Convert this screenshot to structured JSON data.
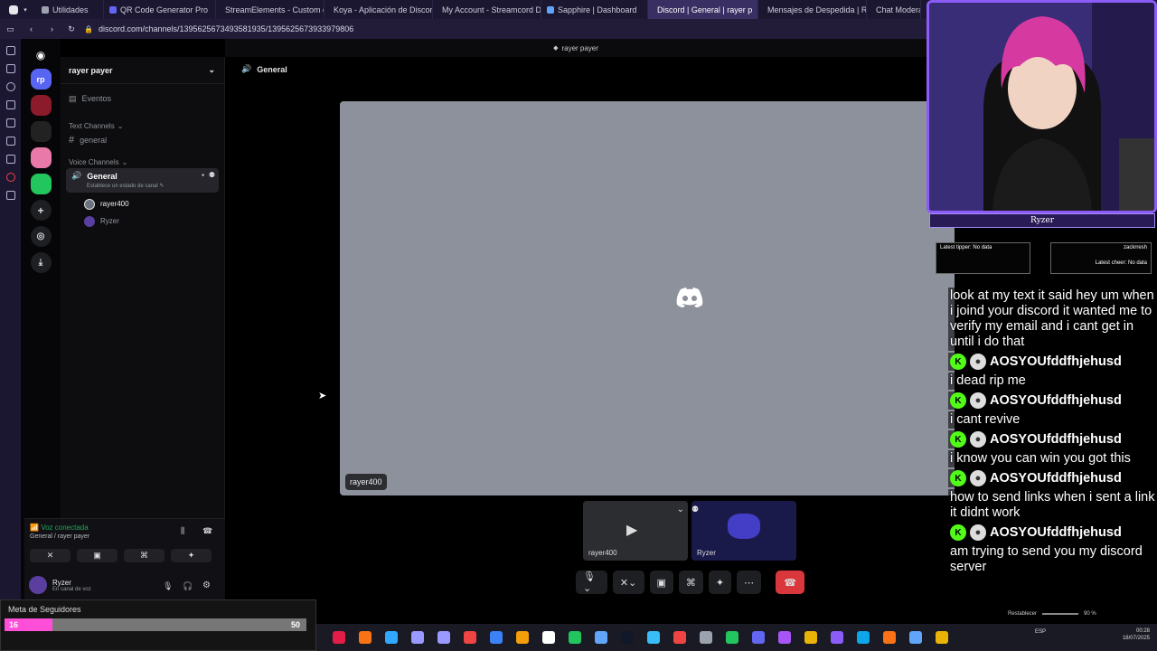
{
  "browser": {
    "tabs": [
      {
        "label": "Utilidades",
        "color": "#9ca3af"
      },
      {
        "label": "QR Code Generator Pro",
        "color": "#6366f1"
      },
      {
        "label": "StreamElements - Custom c",
        "color": "#3b82f6"
      },
      {
        "label": "Koya - Aplicación de Discor",
        "color": "#f59e0b"
      },
      {
        "label": "My Account - Streamcord D",
        "color": "#8b5cf6"
      },
      {
        "label": "Sapphire | Dashboard",
        "color": "#60a5fa"
      },
      {
        "label": "Discord | General | rayer p",
        "color": "#5865f2"
      },
      {
        "label": "Mensajes de Despedida | Re",
        "color": "#ec4899"
      },
      {
        "label": "Chat Modera",
        "color": "#10b981"
      }
    ],
    "url": "discord.com/channels/1395625673493581935/1395625673933979806"
  },
  "servers": [
    {
      "label": "rp",
      "color": "#5865f2"
    },
    {
      "label": "",
      "color": "#8b1a2b"
    },
    {
      "label": "",
      "color": "#222"
    },
    {
      "label": "",
      "color": "#e879a8"
    },
    {
      "label": "",
      "color": "#22c55e"
    }
  ],
  "sidebar": {
    "server_name": "rayer payer",
    "events_label": "Eventos",
    "text_category": "Text Channels",
    "text_channels": [
      "general"
    ],
    "voice_category": "Voice Channels",
    "voice_channel": {
      "name": "General",
      "status": "Establece un estado de canal"
    },
    "voice_users": [
      "rayer400",
      "Ryzer"
    ]
  },
  "voice_panel": {
    "status": "Voz conectada",
    "location": "General / rayer payer",
    "username": "Ryzer",
    "user_status": "En canal de voz"
  },
  "top_strip": {
    "title": "rayer payer"
  },
  "main": {
    "channel_title": "General",
    "video_label": "rayer400",
    "thumbs": [
      "rayer400",
      "Ryzer"
    ]
  },
  "goal": {
    "title": "Meta de Seguidores",
    "current": "16",
    "target": "50",
    "progress": 0.16
  },
  "overlay": {
    "name": "Ryzer",
    "alert_left_1": "Latest tipper: No data",
    "alert_right_1": "zackrresh",
    "alert_right_2": "Latest cheer: No data",
    "chat": [
      {
        "type": "msg",
        "text": "look at my text it said hey um when i joind your discord it wanted me to verify my email and i cant get in until i do that"
      },
      {
        "type": "author",
        "text": "AOSYOUfddfhjehusd"
      },
      {
        "type": "msg",
        "text": "i dead rip me"
      },
      {
        "type": "author",
        "text": "AOSYOUfddfhjehusd"
      },
      {
        "type": "msg",
        "text": "i cant revive"
      },
      {
        "type": "author",
        "text": "AOSYOUfddfhjehusd"
      },
      {
        "type": "msg",
        "text": "i know you can win you got this"
      },
      {
        "type": "author",
        "text": "AOSYOUfddfhjehusd"
      },
      {
        "type": "msg",
        "text": "how to send links when i sent a link it didnt work"
      },
      {
        "type": "author",
        "text": "AOSYOUfddfhjehusd"
      },
      {
        "type": "msg",
        "text": "am trying to send you my discord server"
      }
    ]
  },
  "taskbar": {
    "lang": "ESP",
    "time": "00:28",
    "date": "18/07/2025",
    "restore": "Restablecer",
    "zoom": "90 %",
    "icons": [
      "#e11d48",
      "#f97316",
      "#31a8ff",
      "#9999ff",
      "#9999ff",
      "#ef4444",
      "#3b82f6",
      "#f59e0b",
      "#ffffff",
      "#22c55e",
      "#60a5fa",
      "#111827",
      "#38bdf8",
      "#ef4444",
      "#9ca3af",
      "#22c55e",
      "#6366f1",
      "#a855f7",
      "#eab308",
      "#8b5cf6",
      "#0ea5e9",
      "#f97316",
      "#60a5fa",
      "#eab308"
    ]
  }
}
